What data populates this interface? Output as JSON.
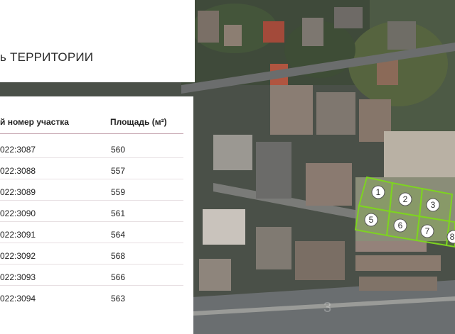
{
  "header": {
    "title": "ь ТЕРРИТОРИИ"
  },
  "table": {
    "columns": [
      "й номер участка",
      "Площадь (м²)"
    ],
    "rows": [
      {
        "number": "022:3087",
        "area": "560"
      },
      {
        "number": "022:3088",
        "area": "557"
      },
      {
        "number": "022:3089",
        "area": "559"
      },
      {
        "number": "022:3090",
        "area": "561"
      },
      {
        "number": "022:3091",
        "area": "564"
      },
      {
        "number": "022:3092",
        "area": "568"
      },
      {
        "number": "022:3093",
        "area": "566"
      },
      {
        "number": "022:3094",
        "area": "563"
      }
    ]
  },
  "map": {
    "plots": [
      "1",
      "2",
      "3",
      "5",
      "6",
      "7",
      "8"
    ],
    "plot_color": "#7ed321",
    "watermark": "3"
  }
}
